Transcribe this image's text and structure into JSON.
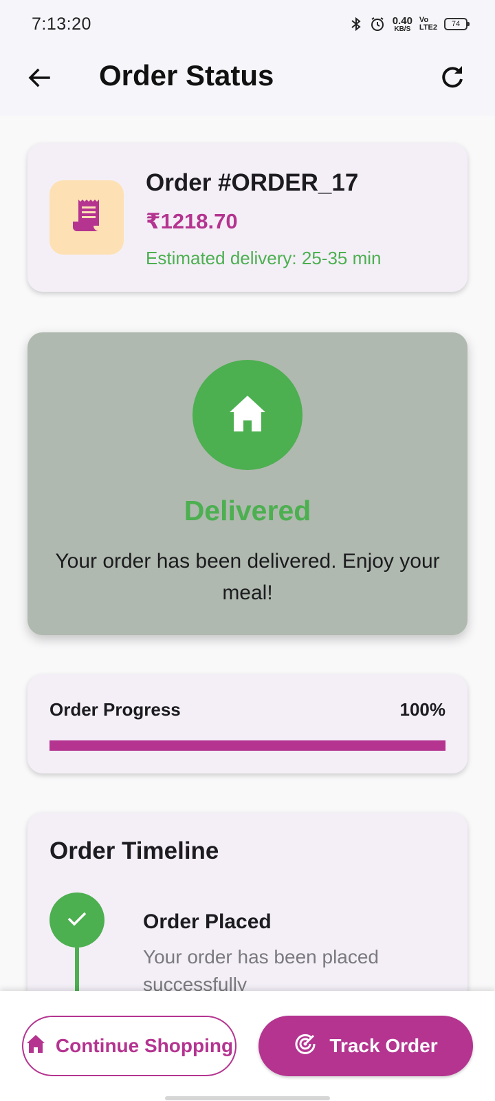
{
  "status_bar": {
    "time": "7:13:20",
    "net_speed_value": "0.40",
    "net_speed_unit": "KB/S",
    "volte_top": "Vo",
    "volte_bottom": "LTE2",
    "battery_level": "74"
  },
  "app_bar": {
    "title": "Order Status",
    "back_icon": "arrow-left-icon",
    "refresh_icon": "refresh-icon"
  },
  "order": {
    "id_label": "Order #ORDER_17",
    "amount": "₹1218.70",
    "eta": "Estimated delivery: 25-35 min",
    "icon": "receipt-icon"
  },
  "delivery_status": {
    "title": "Delivered",
    "message": "Your order has been delivered. Enjoy your meal!",
    "icon": "home-icon"
  },
  "progress": {
    "label": "Order Progress",
    "value_text": "100%",
    "fraction": 1.0
  },
  "timeline": {
    "title": "Order Timeline",
    "steps": [
      {
        "title": "Order Placed",
        "description": "Your order has been placed successfully",
        "icon": "check-icon"
      }
    ]
  },
  "actions": {
    "continue_label": "Continue Shopping",
    "track_label": "Track Order"
  },
  "colors": {
    "primary": "#b43490",
    "success": "#4caf50",
    "card_bg": "#f4eff7",
    "delivered_bg": "#afb9af",
    "order_icon_bg": "#fde1b4"
  }
}
